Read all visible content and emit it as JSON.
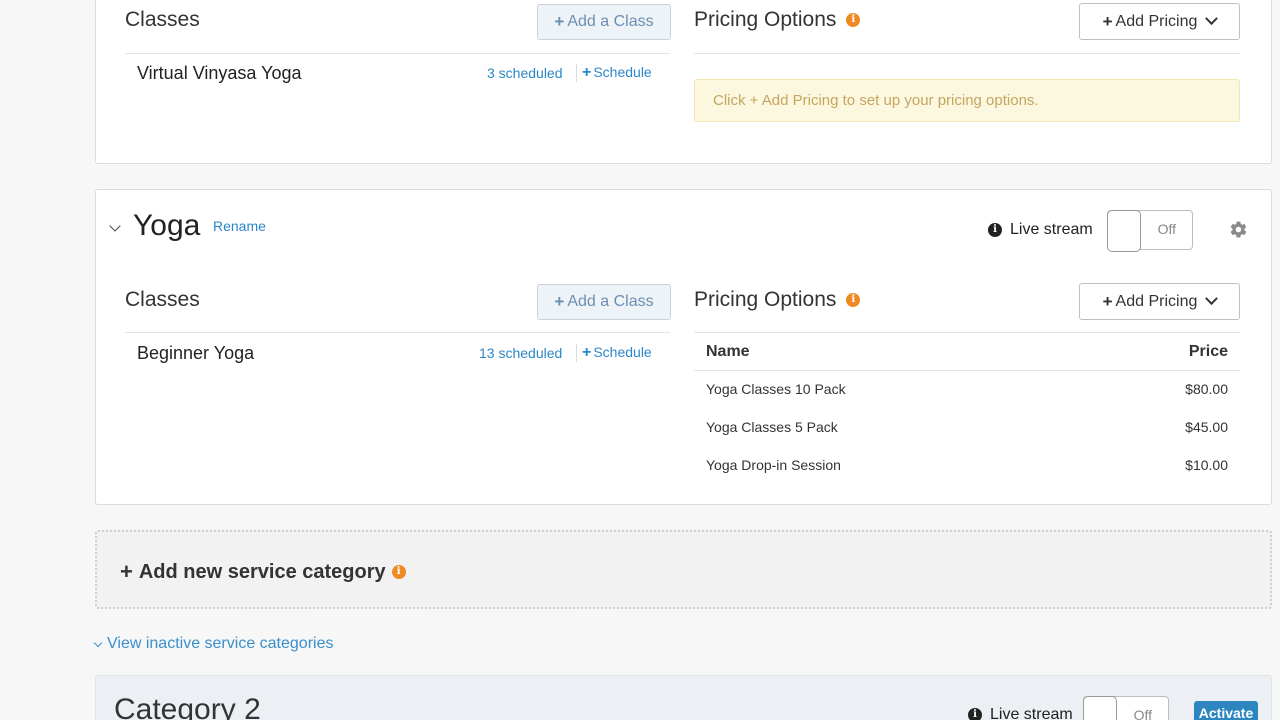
{
  "top_card": {
    "classes_title": "Classes",
    "add_class_label": "Add a Class",
    "pricing_title": "Pricing Options",
    "add_pricing_label": "Add Pricing",
    "class_name": "Virtual Vinyasa Yoga",
    "scheduled": "3 scheduled",
    "schedule_label": "Schedule",
    "notice": "Click + Add Pricing to set up your pricing options."
  },
  "yoga_card": {
    "title": "Yoga",
    "rename_label": "Rename",
    "live_stream_label": "Live stream",
    "toggle_state": "Off",
    "classes_title": "Classes",
    "add_class_label": "Add a Class",
    "pricing_title": "Pricing Options",
    "add_pricing_label": "Add Pricing",
    "class_name": "Beginner Yoga",
    "scheduled": "13 scheduled",
    "schedule_label": "Schedule",
    "table": {
      "col_name": "Name",
      "col_price": "Price",
      "rows": [
        {
          "name": "Yoga Classes 10 Pack",
          "price": "$80.00"
        },
        {
          "name": "Yoga Classes 5 Pack",
          "price": "$45.00"
        },
        {
          "name": "Yoga Drop-in Session",
          "price": "$10.00"
        }
      ]
    }
  },
  "add_category": {
    "label": "Add new service category"
  },
  "inactive_link": {
    "label": "View inactive service categories"
  },
  "category2": {
    "title": "Category 2",
    "live_stream_label": "Live stream",
    "toggle_state": "Off",
    "activate_label": "Activate"
  },
  "colors": {
    "link": "#2a87c7",
    "info": "#f08a24",
    "activate": "#2e86c1"
  },
  "icons": [
    "plus-icon",
    "info-icon",
    "chevron-down-icon",
    "gear-icon"
  ]
}
